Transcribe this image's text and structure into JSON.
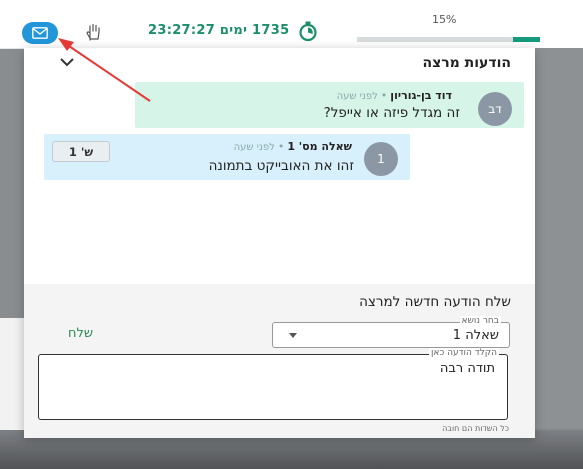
{
  "toolbar": {
    "timer_text": "1735 ימים 23:27:27",
    "progress_label": "15%",
    "progress_value": 0.15,
    "icons": [
      "mail-icon",
      "raise-hand-icon",
      "stopwatch-icon"
    ]
  },
  "messages_panel": {
    "title": "הודעות מרצה",
    "messages": [
      {
        "avatar": "דב",
        "author": "דוד בן-גוריון",
        "time": "לפני שעה",
        "text": "זה מגדל פיזה או אייפל?"
      },
      {
        "avatar": "1",
        "author": "שאלה מס' 1",
        "time": "לפני שעה",
        "text": "זהו את האובייקט בתמונה",
        "tag": "ש' 1"
      }
    ]
  },
  "compose": {
    "title": "שלח הודעה חדשה למרצה",
    "send_label": "שלח",
    "topic_label": "בחר נושא",
    "topic_value": "שאלה 1",
    "message_label": "הקלד הודעה כאן",
    "message_value": "תודה רבה",
    "required_note": "כל השדות הם חובה"
  },
  "colors": {
    "mail_button": "#2196d9",
    "timer": "#1a8f6a",
    "progress": "#159a7e",
    "arrow": "#e53935",
    "lecturer_message": "#d6f5e8",
    "question_message": "#d8f0fb"
  }
}
